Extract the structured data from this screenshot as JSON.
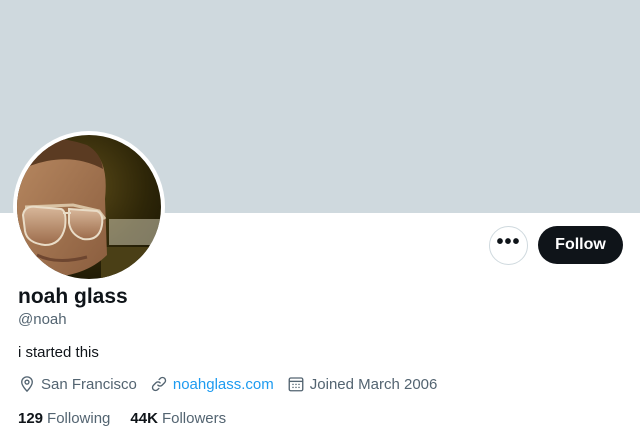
{
  "profile": {
    "display_name": "noah glass",
    "handle": "@noah",
    "bio": "i started this",
    "location": "San Francisco",
    "website": "noahglass.com",
    "joined": "Joined March 2006"
  },
  "actions": {
    "more_label": "•••",
    "follow_label": "Follow"
  },
  "stats": {
    "following_count": "129",
    "following_label": "Following",
    "followers_count": "44K",
    "followers_label": "Followers"
  },
  "colors": {
    "banner": "#cfd9de",
    "primary_text": "#0f1419",
    "secondary_text": "#536471",
    "link": "#1d9bf0",
    "follow_button_bg": "#0f1419"
  },
  "icons": {
    "location": "location-pin-icon",
    "website": "link-icon",
    "joined": "calendar-icon",
    "more": "more-dots-icon"
  }
}
